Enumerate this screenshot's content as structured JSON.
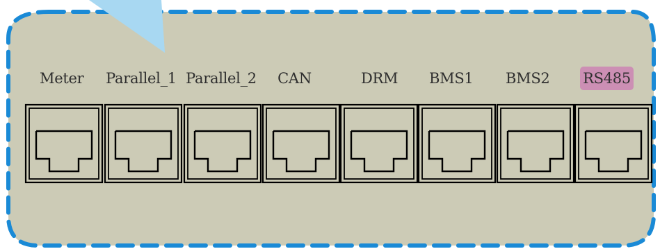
{
  "ports": [
    {
      "label": "Meter",
      "highlighted": false
    },
    {
      "label": "Parallel_1",
      "highlighted": false
    },
    {
      "label": "Parallel_2",
      "highlighted": false
    },
    {
      "label": "CAN",
      "highlighted": false
    },
    {
      "label": "DRM",
      "highlighted": false
    },
    {
      "label": "BMS1",
      "highlighted": false
    },
    {
      "label": "BMS2",
      "highlighted": false
    },
    {
      "label": "RS485",
      "highlighted": true
    }
  ],
  "colors": {
    "panel_fill": "#cccbb6",
    "panel_border": "#1a8ad6",
    "pointer": "#a8d8f2",
    "port_stroke": "#000000",
    "highlight": "#cc8fb4",
    "label_text": "#2f2f2f"
  }
}
